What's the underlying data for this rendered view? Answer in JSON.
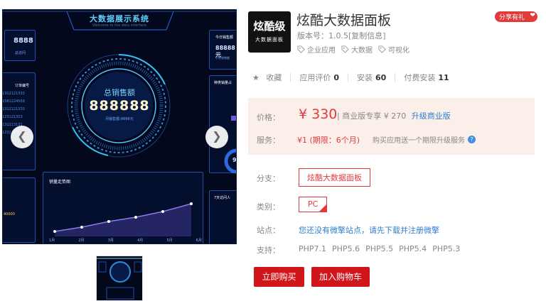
{
  "gallery": {
    "dashboard": {
      "title": "大数据展示系统",
      "subtitle": "Welcome to the data interface",
      "left_top_value": "8888",
      "left_top_label": "总访问",
      "order_header": "订单编号",
      "order_rows": [
        "1312121333",
        "1581224569",
        "1312121333",
        "123121313",
        "131213131",
        "123121313"
      ],
      "left_bottom_value": "40000",
      "center_label": "总销售额",
      "center_value": "888888",
      "center_sub": "月销售额:6666元",
      "right_top_title": "今日销售额",
      "right_top_value": "88888元",
      "right_top_sub": "小公销售额",
      "right_mid_title": "种类销量占",
      "right_mid_value": "93",
      "trend_title": "销量走势图",
      "trend_x": [
        "1月",
        "2月",
        "3月",
        "4月",
        "5月",
        "6月"
      ],
      "right_bottom_title": "7天访问人"
    },
    "prev_icon": "chevron-left-icon",
    "next_icon": "chevron-right-icon"
  },
  "product": {
    "logo_line1": "炫酷级",
    "logo_line2": "大数据面板",
    "title": "炫酷大数据面板",
    "version": "版本号：1.0.5[复制信息]",
    "tags": [
      "企业应用",
      "大数据",
      "可视化"
    ],
    "share": "分享有礼",
    "stats": {
      "fav": "收藏",
      "rating_label": "应用评价",
      "rating": "0",
      "install_label": "安装",
      "install": "60",
      "paid_label": "付费安装",
      "paid": "11"
    },
    "price_label": "价格：",
    "price": "¥ 330",
    "price_extra": "| 商业版专享 ¥ 270",
    "upgrade_link": "升级商业版",
    "service_label": "服务：",
    "service": "¥1 (期限：6个月)",
    "service_note": "购买应用送一个期限升级服务",
    "branch_label": "分支：",
    "branch_value": "炫酷大数据面板",
    "category_label": "类别：",
    "category_value": "PC",
    "site_label": "站点：",
    "site_value": "您还没有微擎站点，请先下载并注册微擎",
    "support_label": "支持：",
    "support_values": [
      "PHP7.1",
      "PHP5.6",
      "PHP5.5",
      "PHP5.4",
      "PHP5.3"
    ],
    "buy_button": "立即购买",
    "cart_button": "加入购物车"
  },
  "colors": {
    "accent": "#e4393c",
    "button": "#d0161b",
    "link": "#2f7fd0",
    "price_bg": "#fbefe9",
    "dash_bg": "#03081c",
    "dash_cyan": "#5fd3ff"
  }
}
